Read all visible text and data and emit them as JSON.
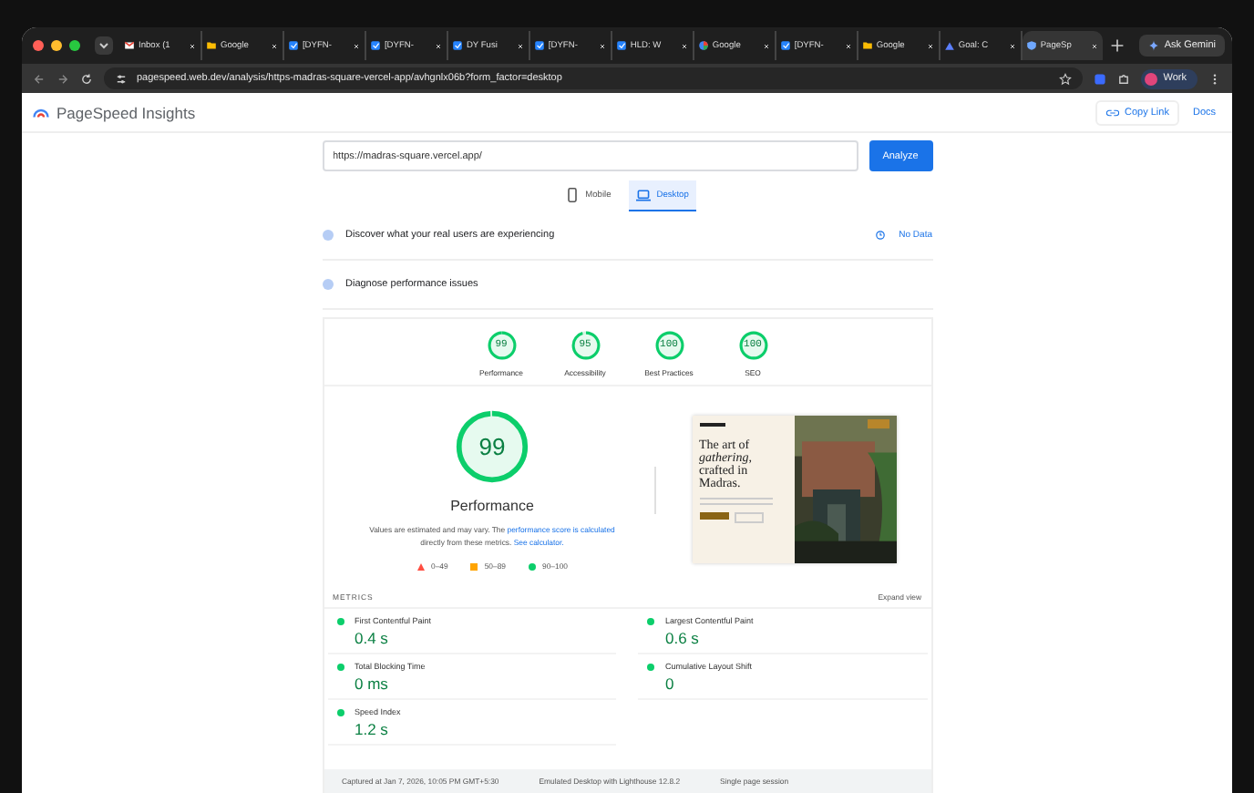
{
  "browser": {
    "tabs": [
      {
        "label": "Inbox (1",
        "kind": "mail",
        "selected": false
      },
      {
        "label": "Google",
        "kind": "folder",
        "selected": false
      },
      {
        "label": "[DYFN-",
        "kind": "task",
        "selected": false
      },
      {
        "label": "[DYFN-",
        "kind": "task",
        "selected": false
      },
      {
        "label": "DY Fusi",
        "kind": "task",
        "selected": false
      },
      {
        "label": "[DYFN-",
        "kind": "task",
        "selected": false
      },
      {
        "label": "HLD: W",
        "kind": "task",
        "selected": false
      },
      {
        "label": "Google",
        "kind": "globe",
        "selected": false
      },
      {
        "label": "[DYFN-",
        "kind": "task",
        "selected": false
      },
      {
        "label": "Google",
        "kind": "folder",
        "selected": false
      },
      {
        "label": "Goal: C",
        "kind": "triangle",
        "selected": false
      },
      {
        "label": "PageSp",
        "kind": "shield",
        "selected": true
      }
    ],
    "address": "pagespeed.web.dev/analysis/https-madras-square-vercel-app/avhgnlx06b?form_factor=desktop",
    "gemini": "Ask Gemini",
    "profile": "Work"
  },
  "header": {
    "title": "PageSpeed Insights",
    "copy_link": "Copy Link",
    "docs": "Docs"
  },
  "url_field": {
    "value": "https://madras-square.vercel.app/"
  },
  "analyze": "Analyze",
  "device_tabs": [
    {
      "label": "Mobile",
      "kind": "phone",
      "selected": false
    },
    {
      "label": "Desktop",
      "kind": "laptop",
      "selected": true
    }
  ],
  "sections": [
    {
      "title": "Discover what your real users are experiencing",
      "status": "No Data"
    },
    {
      "title": "Diagnose performance issues"
    }
  ],
  "scores": [
    {
      "value": "99",
      "label": "Performance"
    },
    {
      "value": "95",
      "label": "Accessibility"
    },
    {
      "value": "100",
      "label": "Best Practices"
    },
    {
      "value": "100",
      "label": "SEO"
    }
  ],
  "gauge": {
    "value": "99",
    "title": "Performance"
  },
  "note": [
    {
      "text": "Values are estimated and may vary. The ",
      "kind": "text"
    },
    {
      "text": "performance score is calculated",
      "kind": "link"
    },
    {
      "text": " directly from these metrics. ",
      "kind": "text"
    },
    {
      "text": "See calculator.",
      "kind": "link"
    }
  ],
  "legend": [
    {
      "range": "0–49",
      "kind": "fail"
    },
    {
      "range": "50–89",
      "kind": "average"
    },
    {
      "range": "90–100",
      "kind": "pass"
    }
  ],
  "preview": {
    "headline": "The art of *gathering,* crafted in Madras."
  },
  "metrics_label": "METRICS",
  "expand": "Expand view",
  "metrics": [
    {
      "name": "First Contentful Paint",
      "value": "0.4 s",
      "color": "#0cce6b"
    },
    {
      "name": "Largest Contentful Paint",
      "value": "0.6 s",
      "color": "#0cce6b"
    },
    {
      "name": "Total Blocking Time",
      "value": "0 ms",
      "color": "#0cce6b"
    },
    {
      "name": "Cumulative Layout Shift",
      "value": "0",
      "color": "#0cce6b"
    },
    {
      "name": "Speed Index",
      "value": "1.2 s",
      "color": "#0cce6b"
    }
  ],
  "footer": [
    "Captured at Jan 7, 2026, 10:05 PM GMT+5:30",
    "Emulated Desktop with Lighthouse 12.8.2",
    "Single page session"
  ]
}
